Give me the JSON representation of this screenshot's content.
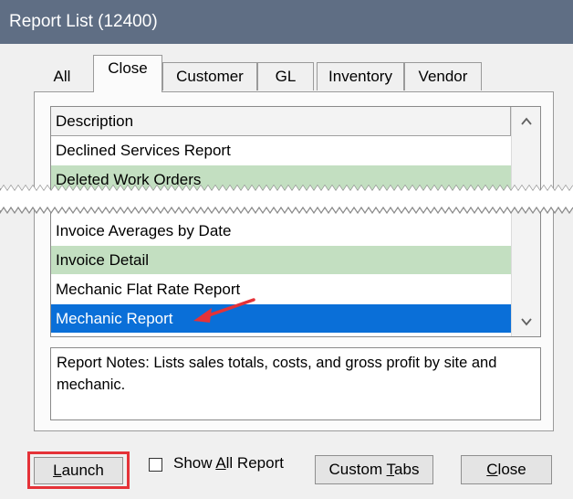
{
  "window": {
    "title": "Report List (12400)"
  },
  "tabs": [
    {
      "label": "All"
    },
    {
      "label": "Close"
    },
    {
      "label": "Customer"
    },
    {
      "label": "GL"
    },
    {
      "label": "Inventory"
    },
    {
      "label": "Vendor"
    }
  ],
  "active_tab": "Close",
  "list": {
    "header": "Description",
    "rows": [
      {
        "label": "Declined Services Report",
        "style": "white"
      },
      {
        "label": "Deleted Work Orders",
        "style": "green"
      },
      {
        "label": "Invoice Averages by Date",
        "style": "white"
      },
      {
        "label": "Invoice Detail",
        "style": "green"
      },
      {
        "label": "Mechanic Flat Rate Report",
        "style": "white"
      },
      {
        "label": "Mechanic Report",
        "style": "selected"
      }
    ]
  },
  "notes": {
    "text": "Report Notes:  Lists sales totals, costs, and gross profit by site and mechanic."
  },
  "buttons": {
    "launch_pre": "",
    "launch_mnemonic": "L",
    "launch_post": "aunch",
    "show_all_pre": "Show ",
    "show_all_mnemonic": "A",
    "show_all_post": "ll Report",
    "custom_tabs_pre": "Custom ",
    "custom_tabs_mnemonic": "T",
    "custom_tabs_post": "abs",
    "close_pre": "",
    "close_mnemonic": "C",
    "close_post": "lose"
  },
  "show_all_checked": false,
  "colors": {
    "titlebar": "#5f6e84",
    "row_green": "#c3dfc1",
    "row_selected": "#0a6fd8",
    "annotation": "#e53238"
  }
}
